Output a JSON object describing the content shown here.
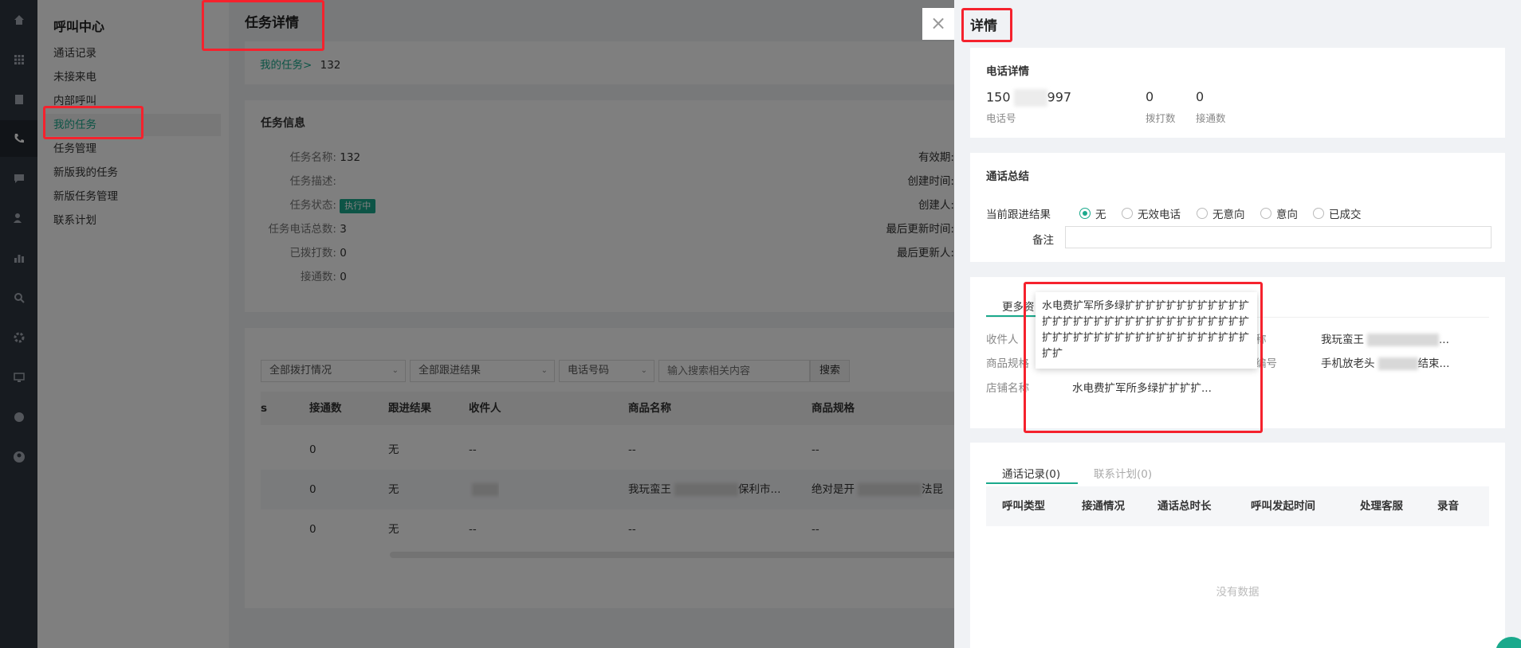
{
  "rail": {
    "icons": [
      "home-icon",
      "grid-icon",
      "document-icon",
      "phone-icon",
      "chat-icon",
      "users-icon",
      "bar-chart-icon",
      "search-icon",
      "gear-icon",
      "monitor-icon",
      "globe-icon",
      "user-circle-icon"
    ]
  },
  "menu": {
    "title": "呼叫中心",
    "items": [
      "通话记录",
      "未接来电",
      "内部呼叫",
      "我的任务",
      "任务管理",
      "新版我的任务",
      "新版任务管理",
      "联系计划"
    ]
  },
  "page": {
    "title": "任务详情",
    "breadcrumb": {
      "parent": "我的任务>",
      "current": "132"
    }
  },
  "task_info": {
    "heading": "任务信息",
    "fields": [
      {
        "label": "任务名称:",
        "value": "132"
      },
      {
        "label": "任务描述:",
        "value": ""
      },
      {
        "label": "任务状态:",
        "value": "执行中"
      },
      {
        "label": "任务电话总数:",
        "value": "3"
      },
      {
        "label": "已拨打数:",
        "value": "0"
      },
      {
        "label": "接通数:",
        "value": "0"
      }
    ],
    "right_fields": [
      "有效期:",
      "创建时间:",
      "创建人:",
      "最后更新时间:",
      "最后更新人:"
    ]
  },
  "filters": {
    "dial_status": "全部拨打情况",
    "follow_result": "全部跟进结果",
    "phone_type": "电话号码",
    "search_placeholder": "输入搜索相关内容",
    "search_button": "搜索"
  },
  "table": {
    "cut_header": "s",
    "columns": [
      "接通数",
      "跟进结果",
      "收件人",
      "商品名称",
      "商品规格"
    ],
    "rows": [
      {
        "connected": "0",
        "result": "无",
        "recipient": "--",
        "product": "--",
        "spec": "--"
      },
      {
        "connected": "0",
        "result": "无",
        "recipient": "",
        "product": "我玩蛮王",
        "product_tail": "保利市...",
        "spec": "绝对是开",
        "spec_tail": "法昆"
      },
      {
        "connected": "0",
        "result": "无",
        "recipient": "--",
        "product": "--",
        "spec": "--"
      }
    ]
  },
  "drawer": {
    "close": "×",
    "title": "详情",
    "phone_detail": {
      "heading": "电话详情",
      "phone_prefix": "150",
      "phone_suffix": "997",
      "phone_label": "电话号",
      "dial_count": "0",
      "dial_label": "拨打数",
      "connect_count": "0",
      "connect_label": "接通数"
    },
    "summary": {
      "heading": "通话总结",
      "follow_label": "当前跟进结果",
      "options": [
        "无",
        "无效电话",
        "无意向",
        "意向",
        "已成交"
      ],
      "selected": "无",
      "memo_label": "备注"
    },
    "more": {
      "tab": "更多资",
      "fields": {
        "recipient_label": "收件人",
        "spec_label": "商品规格",
        "shop_label": "店铺名称",
        "shop_value": "水电费扩军所多绿扩扩扩扩...",
        "name_label": "称",
        "name_value": "我玩蛮王",
        "name_tail": "...",
        "code_label": "编号",
        "code_value": "手机放老头",
        "code_tail": "结束..."
      },
      "tooltip": "水电费扩军所多绿扩扩扩扩扩扩扩扩扩扩扩扩扩扩扩扩扩扩扩扩扩扩扩扩扩扩扩扩扩扩扩扩扩扩扩扩扩扩扩扩扩扩扩扩扩扩扩扩扩扩扩扩扩扩"
    },
    "records": {
      "tabs": [
        "通话记录(0)",
        "联系计划(0)"
      ],
      "columns": [
        "呼叫类型",
        "接通情况",
        "通话总时长",
        "呼叫发起时间",
        "处理客服",
        "录音"
      ],
      "empty": "没有数据"
    }
  },
  "colors": {
    "accent": "#1aa98c",
    "highlight": "#f5222d"
  }
}
